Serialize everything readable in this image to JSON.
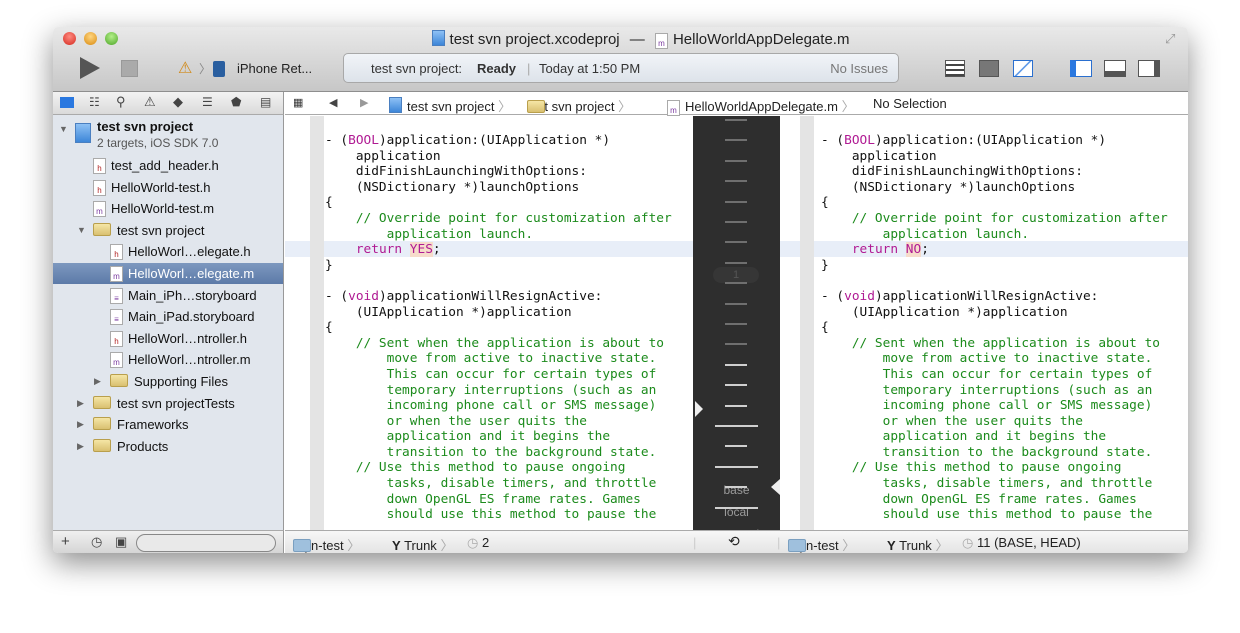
{
  "window": {
    "title_project": "test svn project.xcodeproj",
    "title_dash": "—",
    "title_file": "HelloWorldAppDelegate.m"
  },
  "toolbar": {
    "scheme": "iPhone Ret...",
    "status_project": "test svn project:",
    "status_state": "Ready",
    "status_time": "Today at 1:50 PM",
    "issues": "No Issues"
  },
  "jumpbar": {
    "items": [
      "test svn project",
      "test svn project",
      "HelloWorldAppDelegate.m",
      "No Selection"
    ]
  },
  "navigator": {
    "project": {
      "name": "test svn project",
      "subtitle": "2 targets, iOS SDK 7.0"
    },
    "items": [
      {
        "label": "test_add_header.h",
        "icon": "h-file-icon"
      },
      {
        "label": "HelloWorld-test.h",
        "icon": "h-file-icon"
      },
      {
        "label": "HelloWorld-test.m",
        "icon": "m-file-icon"
      },
      {
        "label": "test svn project",
        "icon": "folder-icon"
      },
      {
        "label": "HelloWorl…elegate.h",
        "icon": "h-file-icon"
      },
      {
        "label": "HelloWorl…elegate.m",
        "icon": "m-file-icon",
        "selected": true
      },
      {
        "label": "Main_iPh…storyboard",
        "icon": "storyboard-icon"
      },
      {
        "label": "Main_iPad.storyboard",
        "icon": "storyboard-icon"
      },
      {
        "label": "HelloWorl…ntroller.h",
        "icon": "h-file-icon"
      },
      {
        "label": "HelloWorl…ntroller.m",
        "icon": "m-file-icon"
      },
      {
        "label": "Supporting Files",
        "icon": "folder-icon"
      },
      {
        "label": "test svn projectTests",
        "icon": "folder-icon"
      },
      {
        "label": "Frameworks",
        "icon": "folder-icon"
      },
      {
        "label": "Products",
        "icon": "folder-icon"
      }
    ]
  },
  "editor_left": {
    "lines": [
      [
        [
          "- (",
          "p"
        ],
        [
          "BOOL",
          "k"
        ],
        [
          ")application:(UIApplication *)",
          "p"
        ]
      ],
      [
        [
          "    application",
          "p"
        ]
      ],
      [
        [
          "    didFinishLaunchingWithOptions:",
          "p"
        ]
      ],
      [
        [
          "    (NSDictionary *)launchOptions",
          "p"
        ]
      ],
      [
        [
          "{",
          "p"
        ]
      ],
      [
        [
          "    // Override point for customization after",
          "c"
        ]
      ],
      [
        [
          "        application launch.",
          "c"
        ]
      ],
      [
        [
          "    ",
          "p"
        ],
        [
          "return",
          "k"
        ],
        [
          " ",
          "p"
        ],
        [
          "YES",
          "hl"
        ],
        [
          ";",
          "p"
        ]
      ],
      [
        [
          "}",
          "p"
        ]
      ],
      [
        [
          "",
          "p"
        ]
      ],
      [
        [
          "- (",
          "p"
        ],
        [
          "void",
          "k"
        ],
        [
          ")applicationWillResignActive:",
          "p"
        ]
      ],
      [
        [
          "    (UIApplication *)application",
          "p"
        ]
      ],
      [
        [
          "{",
          "p"
        ]
      ],
      [
        [
          "    // Sent when the application is about to",
          "c"
        ]
      ],
      [
        [
          "        move from active to inactive state.",
          "c"
        ]
      ],
      [
        [
          "        This can occur for certain types of",
          "c"
        ]
      ],
      [
        [
          "        temporary interruptions (such as an",
          "c"
        ]
      ],
      [
        [
          "        incoming phone call or SMS message)",
          "c"
        ]
      ],
      [
        [
          "        or when the user quits the",
          "c"
        ]
      ],
      [
        [
          "        application and it begins the",
          "c"
        ]
      ],
      [
        [
          "        transition to the background state.",
          "c"
        ]
      ],
      [
        [
          "    // Use this method to pause ongoing",
          "c"
        ]
      ],
      [
        [
          "        tasks, disable timers, and throttle",
          "c"
        ]
      ],
      [
        [
          "        down OpenGL ES frame rates. Games",
          "c"
        ]
      ],
      [
        [
          "        should use this method to pause the",
          "c"
        ]
      ]
    ]
  },
  "editor_right": {
    "lines": [
      [
        [
          "- (",
          "p"
        ],
        [
          "BOOL",
          "k"
        ],
        [
          ")application:(UIApplication *)",
          "p"
        ]
      ],
      [
        [
          "    application",
          "p"
        ]
      ],
      [
        [
          "    didFinishLaunchingWithOptions:",
          "p"
        ]
      ],
      [
        [
          "    (NSDictionary *)launchOptions",
          "p"
        ]
      ],
      [
        [
          "{",
          "p"
        ]
      ],
      [
        [
          "    // Override point for customization after",
          "c"
        ]
      ],
      [
        [
          "        application launch.",
          "c"
        ]
      ],
      [
        [
          "    ",
          "p"
        ],
        [
          "return",
          "k"
        ],
        [
          " ",
          "p"
        ],
        [
          "NO",
          "hl"
        ],
        [
          ";",
          "p"
        ]
      ],
      [
        [
          "}",
          "p"
        ]
      ],
      [
        [
          "",
          "p"
        ]
      ],
      [
        [
          "- (",
          "p"
        ],
        [
          "void",
          "k"
        ],
        [
          ")applicationWillResignActive:",
          "p"
        ]
      ],
      [
        [
          "    (UIApplication *)application",
          "p"
        ]
      ],
      [
        [
          "{",
          "p"
        ]
      ],
      [
        [
          "    // Sent when the application is about to",
          "c"
        ]
      ],
      [
        [
          "        move from active to inactive state.",
          "c"
        ]
      ],
      [
        [
          "        This can occur for certain types of",
          "c"
        ]
      ],
      [
        [
          "        temporary interruptions (such as an",
          "c"
        ]
      ],
      [
        [
          "        incoming phone call or SMS message)",
          "c"
        ]
      ],
      [
        [
          "        or when the user quits the",
          "c"
        ]
      ],
      [
        [
          "        application and it begins the",
          "c"
        ]
      ],
      [
        [
          "        transition to the background state.",
          "c"
        ]
      ],
      [
        [
          "    // Use this method to pause ongoing",
          "c"
        ]
      ],
      [
        [
          "        tasks, disable timers, and throttle",
          "c"
        ]
      ],
      [
        [
          "        down OpenGL ES frame rates. Games",
          "c"
        ]
      ],
      [
        [
          "        should use this method to pause the",
          "c"
        ]
      ]
    ]
  },
  "timeline": {
    "labels": [
      "base",
      "local",
      "unsaved"
    ],
    "change_count": "1"
  },
  "bottom_left": {
    "repo": "aryn-test",
    "branch": "Trunk",
    "revision": "2"
  },
  "bottom_right": {
    "repo": "aryn-test",
    "branch": "Trunk",
    "revision": "11 (BASE, HEAD)"
  }
}
